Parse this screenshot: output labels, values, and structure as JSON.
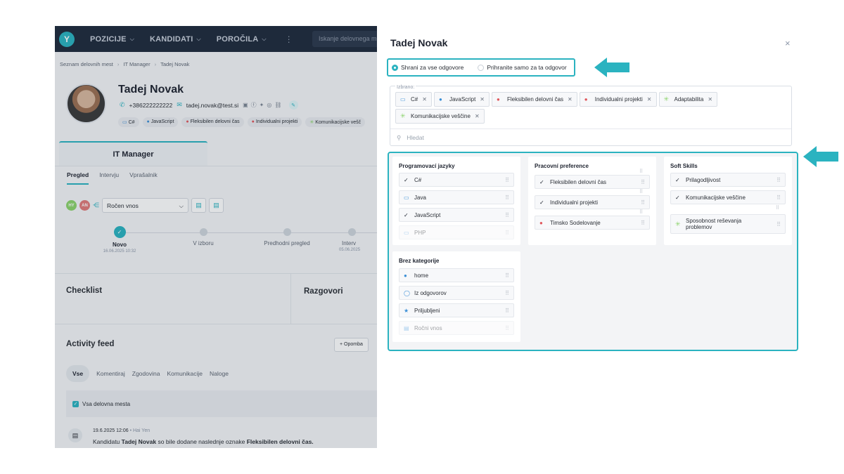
{
  "nav": {
    "items": [
      "POZICIJE",
      "KANDIDATI",
      "POROČILA"
    ],
    "more": "⋮",
    "search_placeholder": "Iskanje delovnega m"
  },
  "breadcrumb": [
    "Seznam delovnih mest",
    "IT Manager",
    "Tadej Novak"
  ],
  "candidate": {
    "name": "Tadej Novak",
    "phone": "+386222222222",
    "email": "tadej.novak@test.si",
    "tags": [
      "C#",
      "JavaScript",
      "Fleksibilen delovni čas",
      "Individualni projekti",
      "Komunikacijske vešč"
    ]
  },
  "job_tab": "IT Manager",
  "subtabs": [
    "Pregled",
    "Intervju",
    "Vprašalnik"
  ],
  "toolbar": {
    "avatar1": "HY",
    "avatar2": "AN",
    "select_value": "Ročen vnos"
  },
  "pipeline": [
    {
      "label": "Novo",
      "date": "16.06.2025 10:32"
    },
    {
      "label": "V izboru",
      "date": ""
    },
    {
      "label": "Predhodni pregled",
      "date": ""
    },
    {
      "label": "Interv",
      "date": "05.06.2025"
    }
  ],
  "sections": {
    "checklist": "Checklist",
    "razgovori": "Razgovori"
  },
  "feed": {
    "title": "Activity feed",
    "add_button": "+ Opomba",
    "tabs": [
      "Vse",
      "Komentiraj",
      "Zgodovina",
      "Komunikacije",
      "Naloge"
    ],
    "filter_label": "Vsa delovna mesta",
    "entry_date": "19.6.2025 12:06",
    "entry_author": "Hai Yen",
    "entry_prefix": "Kandidatu",
    "entry_name": "Tadej Novak",
    "entry_middle": "so bile dodane naslednje oznake",
    "entry_tag": "Fleksibilen delovni čas."
  },
  "panel": {
    "title": "Tadej Novak",
    "close": "×",
    "radio_all": "Shrani za vse odgovore",
    "radio_this": "Prihranite samo za ta odgovor",
    "selected_label": "Izbrano:",
    "selected_chips": [
      {
        "label": "C#",
        "icon": "monitor-icon"
      },
      {
        "label": "JavaScript",
        "icon": "person-icon-blue"
      },
      {
        "label": "Fleksibilen delovni čas",
        "icon": "person-icon-red"
      },
      {
        "label": "Individualni projekti",
        "icon": "person-icon-red"
      },
      {
        "label": "Adaptabilita",
        "icon": "star-icon"
      },
      {
        "label": "Komunikacijske veščine",
        "icon": "star-icon"
      }
    ],
    "search_placeholder": "Hledat",
    "columns": [
      {
        "title": "Programovací jazyky",
        "items": [
          "C#",
          "Java",
          "JavaScript",
          "PHP"
        ]
      },
      {
        "title": "Pracovní preference",
        "items": [
          "Fleksibilen delovni čas",
          "Individualni projekti",
          "Timsko Sodelovanje"
        ]
      },
      {
        "title": "Soft Skills",
        "items": [
          "Prilagodljivost",
          "Komunikacijske veščine",
          "Sposobnost reševanja problemov"
        ]
      },
      {
        "title": "Brez kategorije",
        "items": [
          "home",
          "Iz odgovorov",
          "Priljubljeni",
          "Ročni vnos"
        ]
      }
    ]
  },
  "colors": {
    "accent": "#2bb3c0",
    "topbar": "#1f2a3c"
  }
}
